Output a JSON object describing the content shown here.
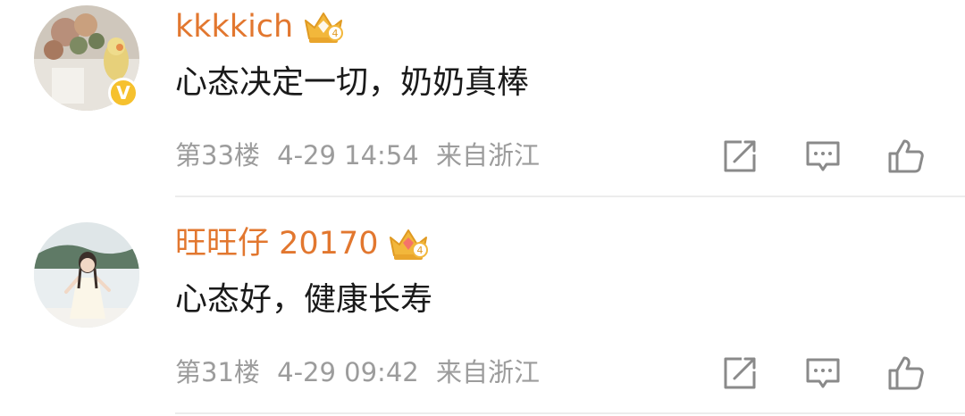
{
  "comments": [
    {
      "username": "kkkkich",
      "text": "心态决定一切，奶奶真棒",
      "floor": "第33楼",
      "time": "4-29 14:54",
      "source": "来自浙江",
      "verified_badge": "V",
      "badge_icon": "crown-icon",
      "badge_level": "4"
    },
    {
      "username": "旺旺仔 20170",
      "text": "心态好，健康长寿",
      "floor": "第31楼",
      "time": "4-29 09:42",
      "source": "来自浙江",
      "badge_icon": "crown-icon",
      "badge_level": "4"
    }
  ],
  "actions": [
    "repost-icon",
    "reply-icon",
    "like-icon"
  ],
  "colors": {
    "username": "#e2772f",
    "text": "#1a1a1a",
    "meta": "#9c9c9c",
    "icon": "#8a8a8a",
    "crown_gold": "#f2b73b",
    "verified": "#f6c12e"
  }
}
